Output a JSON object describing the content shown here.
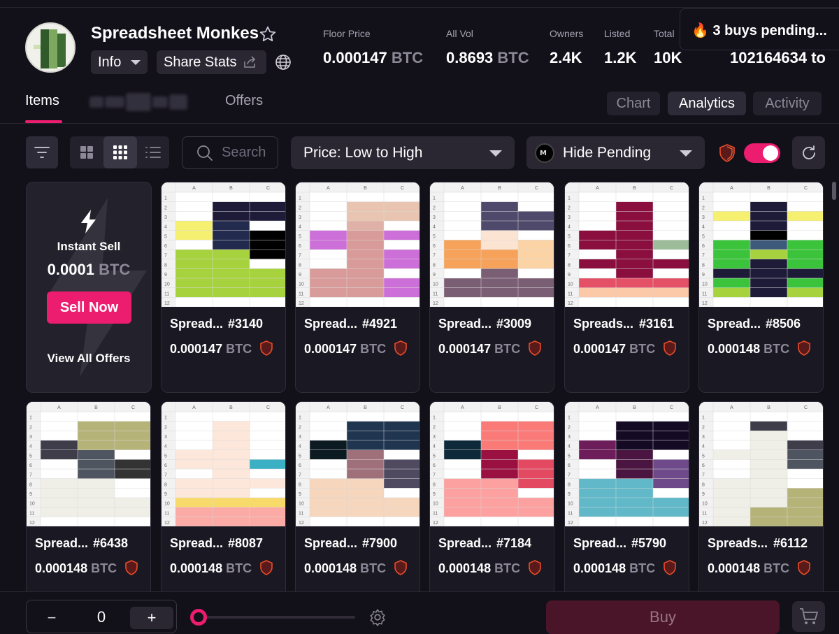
{
  "collection": {
    "name": "Spreadsheet Monkes",
    "info_label": "Info",
    "share_label": "Share Stats"
  },
  "stats": [
    {
      "label": "Floor Price",
      "value": "0.000147",
      "unit": "BTC"
    },
    {
      "label": "All Vol",
      "value": "0.8693",
      "unit": "BTC"
    },
    {
      "label": "Owners",
      "value": "2.4K",
      "unit": ""
    },
    {
      "label": "Listed",
      "value": "1.2K",
      "unit": ""
    },
    {
      "label": "Total",
      "value": "10K",
      "unit": ""
    },
    {
      "label": "",
      "value": "102164634 to",
      "unit": ""
    }
  ],
  "pending_banner": "🔥 3 buys pending...",
  "tabs": {
    "items": "Items",
    "offers": "Offers"
  },
  "right_tabs": {
    "chart": "Chart",
    "analytics": "Analytics",
    "activity": "Activity"
  },
  "toolbar": {
    "search_placeholder": "Search",
    "sort_value": "Price: Low to High",
    "pending_filter": "Hide Pending"
  },
  "instant_sell": {
    "title": "Instant Sell",
    "amount": "0.0001",
    "unit": "BTC",
    "button": "Sell Now",
    "view_all": "View All Offers"
  },
  "items": [
    {
      "name": "Spread...",
      "number": "#3140",
      "price": "0.000147",
      "unit": "BTC"
    },
    {
      "name": "Spread...",
      "number": "#4921",
      "price": "0.000147",
      "unit": "BTC"
    },
    {
      "name": "Spread...",
      "number": "#3009",
      "price": "0.000147",
      "unit": "BTC"
    },
    {
      "name": "Spreads...",
      "number": "#3161",
      "price": "0.000147",
      "unit": "BTC"
    },
    {
      "name": "Spread...",
      "number": "#8506",
      "price": "0.000148",
      "unit": "BTC"
    },
    {
      "name": "Spread...",
      "number": "#6438",
      "price": "0.000148",
      "unit": "BTC"
    },
    {
      "name": "Spread...",
      "number": "#8087",
      "price": "0.000148",
      "unit": "BTC"
    },
    {
      "name": "Spread...",
      "number": "#7900",
      "price": "0.000148",
      "unit": "BTC"
    },
    {
      "name": "Spread...",
      "number": "#7184",
      "price": "0.000148",
      "unit": "BTC"
    },
    {
      "name": "Spread...",
      "number": "#5790",
      "price": "0.000148",
      "unit": "BTC"
    },
    {
      "name": "Spreads...",
      "number": "#6112",
      "price": "0.000148",
      "unit": "BTC"
    }
  ],
  "sheet_labels": {
    "columns": [
      "A",
      "B",
      "C"
    ],
    "rows": [
      "1",
      "2",
      "3",
      "4",
      "5",
      "6",
      "7",
      "8",
      "9",
      "10",
      "11",
      "12"
    ]
  },
  "bottom_bar": {
    "quantity": "0",
    "minus": "−",
    "plus": "+",
    "buy": "Buy"
  },
  "colors": {
    "accent": "#ec1c6f",
    "background": "#121019",
    "card": "#1a1822",
    "muted": "#8c8896"
  }
}
